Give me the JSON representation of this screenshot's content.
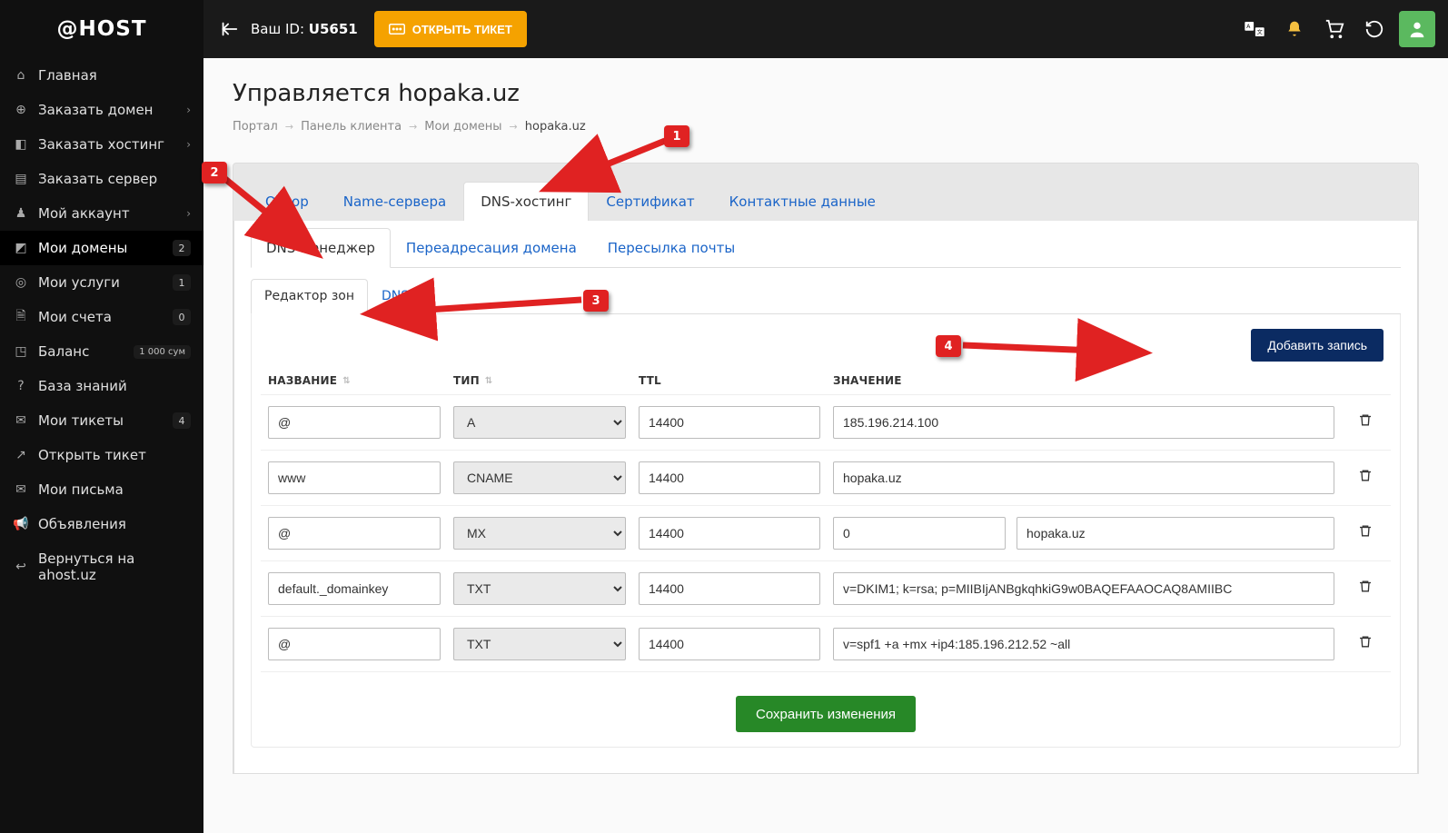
{
  "logo_text": "@HOST",
  "topbar": {
    "userid_prefix": "Ваш ID: ",
    "userid_value": "U5651",
    "open_ticket": "ОТКРЫТЬ ТИКЕТ"
  },
  "sidebar": {
    "items": [
      {
        "icon": "⌂",
        "label": "Главная"
      },
      {
        "icon": "⊕",
        "label": "Заказать домен",
        "chev": true
      },
      {
        "icon": "◧",
        "label": "Заказать хостинг",
        "chev": true
      },
      {
        "icon": "▤",
        "label": "Заказать сервер"
      },
      {
        "icon": "♟",
        "label": "Мой аккаунт",
        "chev": true
      },
      {
        "icon": "◩",
        "label": "Мои домены",
        "badge": "2",
        "active": true
      },
      {
        "icon": "◎",
        "label": "Мои услуги",
        "badge": "1"
      },
      {
        "icon": "🗎",
        "label": "Мои счета",
        "badge": "0"
      },
      {
        "icon": "◳",
        "label": "Баланс",
        "balance": "1 000 сум"
      },
      {
        "icon": "?",
        "label": "База знаний"
      },
      {
        "icon": "✉",
        "label": "Мои тикеты",
        "badge": "4"
      },
      {
        "icon": "↗",
        "label": "Открыть тикет"
      },
      {
        "icon": "✉",
        "label": "Мои письма"
      },
      {
        "icon": "📢",
        "label": "Объявления"
      },
      {
        "icon": "↩",
        "label": "Вернуться на ahost.uz"
      }
    ]
  },
  "page_title": "Управляется hopaka.uz",
  "breadcrumb": {
    "items": [
      "Портал",
      "Панель клиента",
      "Мои домены",
      "hopaka.uz"
    ],
    "current_index": 3
  },
  "tabs_main": [
    "Обзор",
    "Name-сервера",
    "DNS-хостинг",
    "Сертификат",
    "Контактные данные"
  ],
  "tabs_main_active": 2,
  "tabs_sub": [
    "DNS-менеджер",
    "Переадресация домена",
    "Пересылка почты"
  ],
  "tabs_sub_active": 0,
  "tabs_zone": [
    "Редактор зон",
    "DNSSEC"
  ],
  "tabs_zone_active": 0,
  "add_record_label": "Добавить запись",
  "table_headers": {
    "name": "НАЗВАНИЕ",
    "type": "ТИП",
    "ttl": "TTL",
    "value": "ЗНАЧЕНИЕ"
  },
  "records": [
    {
      "name": "@",
      "type": "A",
      "ttl": "14400",
      "value": "185.196.214.100"
    },
    {
      "name": "www",
      "type": "CNAME",
      "ttl": "14400",
      "value": "hopaka.uz"
    },
    {
      "name": "@",
      "type": "MX",
      "ttl": "14400",
      "mx_priority": "0",
      "mx_host": "hopaka.uz"
    },
    {
      "name": "default._domainkey",
      "type": "TXT",
      "ttl": "14400",
      "value": "v=DKIM1; k=rsa; p=MIIBIjANBgkqhkiG9w0BAQEFAAOCAQ8AMIIBC"
    },
    {
      "name": "@",
      "type": "TXT",
      "ttl": "14400",
      "value": "v=spf1 +a +mx +ip4:185.196.212.52 ~all"
    }
  ],
  "save_label": "Сохранить изменения",
  "annotations": {
    "n1": "1",
    "n2": "2",
    "n3": "3",
    "n4": "4"
  }
}
